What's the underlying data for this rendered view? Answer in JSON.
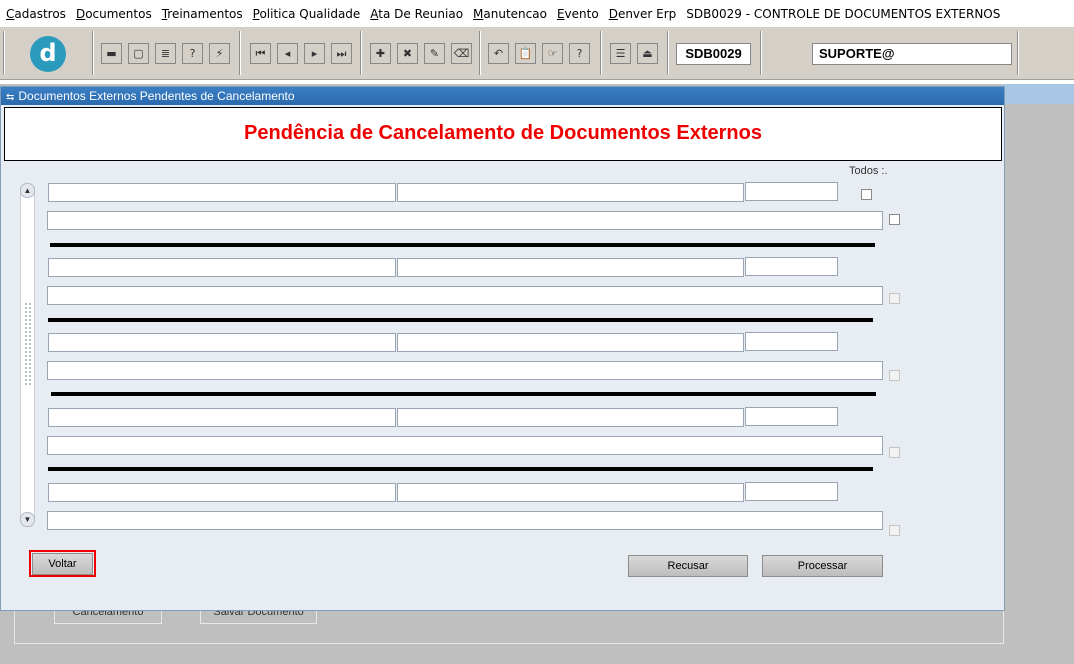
{
  "menu": {
    "items": [
      {
        "accel": "C",
        "rest": "adastros"
      },
      {
        "accel": "D",
        "rest": "ocumentos"
      },
      {
        "accel": "T",
        "rest": "reinamentos"
      },
      {
        "accel": "P",
        "rest": "olitica Qualidade"
      },
      {
        "accel": "A",
        "rest": "ta De Reuniao"
      },
      {
        "accel": "M",
        "rest": "anutencao"
      },
      {
        "accel": "E",
        "rest": "vento"
      },
      {
        "accel": "D",
        "rest": "enver Erp"
      }
    ],
    "window_title": "SDB0029 - CONTROLE DE DOCUMENTOS EXTERNOS"
  },
  "toolbar": {
    "logo_letter": "d",
    "form_code": "SDB0029",
    "user": "SUPORTE@",
    "icons": [
      "save-icon",
      "window-icon",
      "print-icon",
      "query-help-icon",
      "execute-query-icon",
      "first-record-icon",
      "previous-record-icon",
      "next-record-icon",
      "last-record-icon",
      "insert-record-icon",
      "delete-record-icon",
      "edit-record-icon",
      "clear-icon",
      "undo-icon",
      "paste-icon",
      "lov-icon",
      "help-icon",
      "menu-icon",
      "exit-icon"
    ],
    "glyphs": {
      "save": "▬",
      "window": "▢",
      "print": "≣",
      "query": "?",
      "execute": "⚡",
      "first": "⏮",
      "prev": "◂",
      "next": "▸",
      "last": "⏭",
      "insert": "✚",
      "delete": "✖",
      "edit": "✎",
      "clear": "⌫",
      "undo": "↶",
      "paste": "📋",
      "lov": "☞",
      "help": "?",
      "menu": "☰",
      "exit": "⏏"
    }
  },
  "background": {
    "button_1": "Cancelamento",
    "button_2": "Salvar Documento"
  },
  "dialog": {
    "title": "Documentos Externos Pendentes de Cancelamento",
    "title_icon": "form-icon",
    "header": "Pendência de Cancelamento de Documentos Externos",
    "todos_label": "Todos :.",
    "records": [
      {
        "field_1": "",
        "field_2": "",
        "field_3": "",
        "description": "",
        "selected": false
      },
      {
        "field_1": "",
        "field_2": "",
        "field_3": "",
        "description": "",
        "selected": false
      },
      {
        "field_1": "",
        "field_2": "",
        "field_3": "",
        "description": "",
        "selected": false
      },
      {
        "field_1": "",
        "field_2": "",
        "field_3": "",
        "description": "",
        "selected": false
      },
      {
        "field_1": "",
        "field_2": "",
        "field_3": "",
        "description": "",
        "selected": false
      }
    ],
    "buttons": {
      "voltar": "Voltar",
      "recusar": "Recusar",
      "processar": "Processar"
    },
    "scroll_up": "▲",
    "scroll_down": "▼"
  }
}
